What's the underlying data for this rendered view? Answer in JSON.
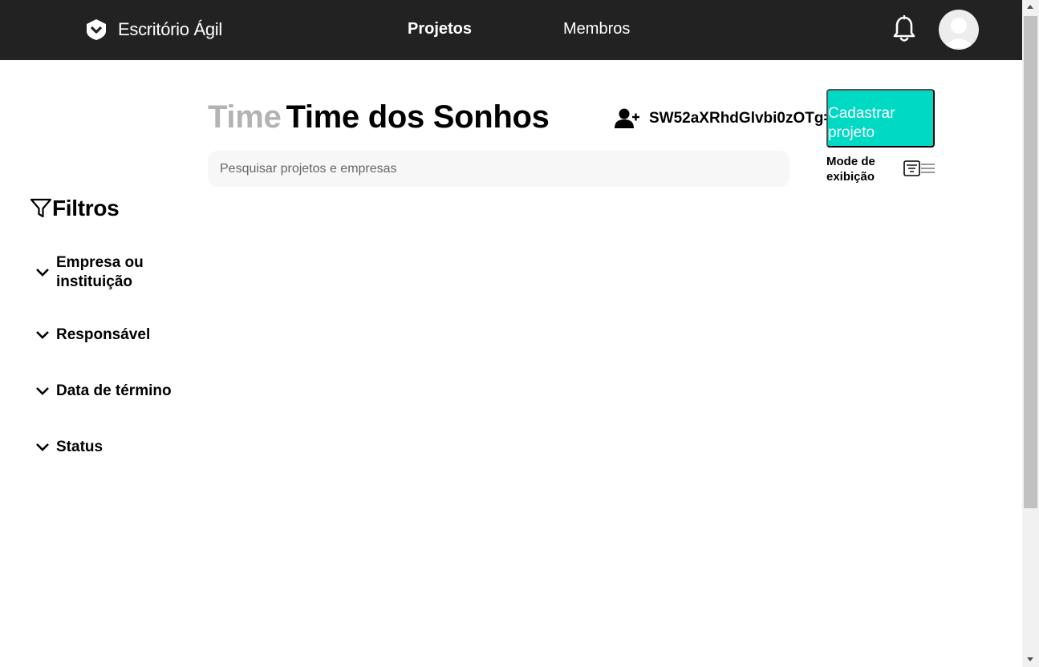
{
  "navbar": {
    "brand_name": "Escritório Ágil",
    "links": {
      "projetos": "Projetos",
      "membros": "Membros"
    },
    "active_link": "Projetos"
  },
  "header": {
    "title_prefix": "Time",
    "team_name": "Time dos Sonhos",
    "invite_code": "SW52aXRhdGlvbi0zOTg=",
    "register_button": "Cadastrar projeto"
  },
  "search": {
    "placeholder": "Pesquisar projetos e empresas",
    "value": ""
  },
  "view_mode": {
    "label": "Mode de exibição"
  },
  "filters": {
    "title": "Filtros",
    "items": [
      {
        "label": "Empresa ou instituição"
      },
      {
        "label": "Responsável"
      },
      {
        "label": "Data de término"
      },
      {
        "label": "Status"
      }
    ]
  },
  "colors": {
    "navbar_bg": "#222222",
    "accent": "#00d9c4",
    "title_prefix": "#b3b3b3",
    "search_bg": "#f7f7f7"
  }
}
